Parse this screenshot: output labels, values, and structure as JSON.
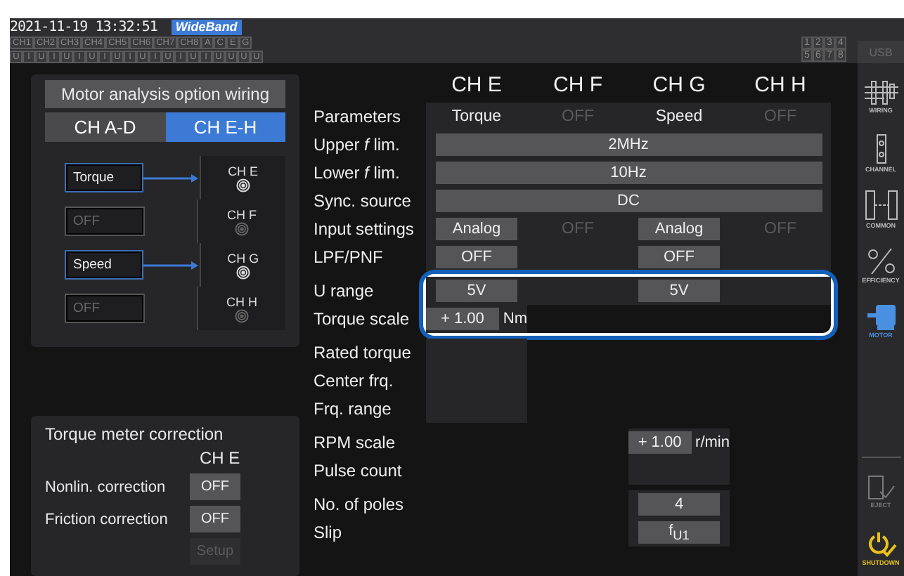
{
  "status_bar": {
    "datetime": "2021-11-19 13:32:51",
    "mode": "WideBand",
    "channels": [
      "CH1",
      "CH2",
      "CH3",
      "CH4",
      "CH5",
      "CH6",
      "CH7",
      "CH8",
      "A",
      "C",
      "E",
      "G"
    ],
    "inputs": [
      "U",
      "I",
      "U",
      "I",
      "U",
      "I",
      "U",
      "I",
      "U",
      "I",
      "U",
      "I",
      "U",
      "I",
      "U",
      "I",
      "U",
      "U",
      "U",
      "U"
    ],
    "displays": [
      "1",
      "2",
      "3",
      "4",
      "5",
      "6",
      "7",
      "8"
    ],
    "usb": "USB"
  },
  "wiring": {
    "title": "Motor analysis option wiring",
    "tabs": [
      {
        "label": "CH A-D",
        "selected": false
      },
      {
        "label": "CH E-H",
        "selected": true
      }
    ],
    "inputs": [
      {
        "label": "Torque",
        "active": true
      },
      {
        "label": "OFF",
        "active": false
      },
      {
        "label": "Speed",
        "active": true
      },
      {
        "label": "OFF",
        "active": false
      }
    ],
    "channels": [
      {
        "label": "CH E",
        "connected": true
      },
      {
        "label": "CH F",
        "connected": false
      },
      {
        "label": "CH G",
        "connected": true
      },
      {
        "label": "CH H",
        "connected": false
      }
    ]
  },
  "correction": {
    "title": "Torque meter correction",
    "channel": "CH E",
    "rows": [
      {
        "label": "Nonlin. correction",
        "value": "OFF",
        "disabled": false
      },
      {
        "label": "Friction correction",
        "value": "OFF",
        "disabled": false
      },
      {
        "value": "Setup",
        "disabled": true
      }
    ]
  },
  "table": {
    "columns": [
      "CH E",
      "CH F",
      "CH G",
      "CH H"
    ],
    "sections": [
      {
        "rows": [
          {
            "label": "Parameters",
            "kind": "cells",
            "cells": [
              {
                "value": "Torque",
                "kind": "text",
                "panel": true
              },
              {
                "value": "OFF",
                "kind": "dim",
                "panel": true
              },
              {
                "value": "Speed",
                "kind": "text",
                "panel": true
              },
              {
                "value": "OFF",
                "kind": "dim",
                "panel": true
              }
            ]
          },
          {
            "label": "Upper *f* lim.",
            "kind": "span",
            "value": "2MHz"
          },
          {
            "label": "Lower *f* lim.",
            "kind": "span",
            "value": "10Hz"
          },
          {
            "label": "Sync. source",
            "kind": "span",
            "value": "DC"
          },
          {
            "label": "Input settings",
            "kind": "cells",
            "cells": [
              {
                "value": "Analog",
                "kind": "button",
                "panel": true
              },
              {
                "value": "OFF",
                "kind": "dim",
                "panel": true
              },
              {
                "value": "Analog",
                "kind": "button",
                "panel": true
              },
              {
                "value": "OFF",
                "kind": "dim",
                "panel": true
              }
            ]
          },
          {
            "label": "LPF/PNF",
            "kind": "cells",
            "cells": [
              {
                "value": "OFF",
                "kind": "button",
                "panel": true
              },
              {
                "kind": "blank",
                "panel": true
              },
              {
                "value": "OFF",
                "kind": "button",
                "panel": true
              },
              {
                "kind": "blank",
                "panel": true
              }
            ]
          }
        ]
      },
      {
        "highlighted": true,
        "rows": [
          {
            "label": "U range",
            "kind": "cells",
            "cells": [
              {
                "value": "5V",
                "kind": "button",
                "panel": true
              },
              {
                "kind": "blank",
                "panel": true
              },
              {
                "value": "5V",
                "kind": "button",
                "panel": true
              },
              {
                "kind": "blank",
                "panel": true
              }
            ]
          },
          {
            "label": "Torque scale",
            "kind": "cells",
            "cells": [
              {
                "value": "+  1.00",
                "kind": "button",
                "panel": true,
                "unit": "Nm"
              },
              {
                "kind": "blank"
              },
              {
                "kind": "blank"
              },
              {
                "kind": "blank"
              }
            ]
          }
        ]
      },
      {
        "rows": [
          {
            "label": "Rated torque",
            "kind": "cells",
            "cells": [
              {
                "kind": "blank",
                "panel": true
              },
              {
                "kind": "blank"
              },
              {
                "kind": "blank"
              },
              {
                "kind": "blank"
              }
            ]
          },
          {
            "label": "Center frq.",
            "kind": "cells",
            "cells": [
              {
                "kind": "blank",
                "panel": true
              },
              {
                "kind": "blank"
              },
              {
                "kind": "blank"
              },
              {
                "kind": "blank"
              }
            ]
          },
          {
            "label": "Frq. range",
            "kind": "cells",
            "cells": [
              {
                "kind": "blank",
                "panel": true
              },
              {
                "kind": "blank"
              },
              {
                "kind": "blank"
              },
              {
                "kind": "blank"
              }
            ]
          }
        ]
      },
      {
        "rows": [
          {
            "label": "RPM scale",
            "kind": "cells",
            "cells": [
              {
                "kind": "blank"
              },
              {
                "kind": "blank"
              },
              {
                "value": "+  1.00",
                "kind": "button",
                "panel": true,
                "unit": "r/min"
              },
              {
                "kind": "blank"
              }
            ]
          },
          {
            "label": "Pulse count",
            "kind": "cells",
            "cells": [
              {
                "kind": "blank"
              },
              {
                "kind": "blank"
              },
              {
                "kind": "blank",
                "panel": true
              },
              {
                "kind": "blank"
              }
            ]
          }
        ]
      },
      {
        "rows": [
          {
            "label": "No. of poles",
            "kind": "cells",
            "cells": [
              {
                "kind": "blank"
              },
              {
                "kind": "blank"
              },
              {
                "value": "4",
                "kind": "button",
                "panel": true
              },
              {
                "kind": "blank"
              }
            ]
          },
          {
            "label": "Slip",
            "kind": "cells",
            "cells": [
              {
                "kind": "blank"
              },
              {
                "kind": "blank"
              },
              {
                "value": "f$_{U1}$",
                "kind": "button",
                "panel": true
              },
              {
                "kind": "blank"
              }
            ]
          }
        ]
      }
    ]
  },
  "sidebar": {
    "items": [
      {
        "label": "WIRING",
        "kind": "wiring",
        "selected": false
      },
      {
        "label": "CHANNEL",
        "kind": "channel",
        "selected": false
      },
      {
        "label": "COMMON",
        "kind": "common",
        "selected": false
      },
      {
        "label": "EFFICIENCY",
        "kind": "efficiency",
        "selected": false
      },
      {
        "label": "MOTOR",
        "kind": "motor",
        "selected": true
      }
    ],
    "actions": [
      {
        "label": "EJECT",
        "kind": "eject",
        "disabled": true
      },
      {
        "label": "SHUTDOWN",
        "kind": "shutdown",
        "disabled": false
      }
    ]
  }
}
